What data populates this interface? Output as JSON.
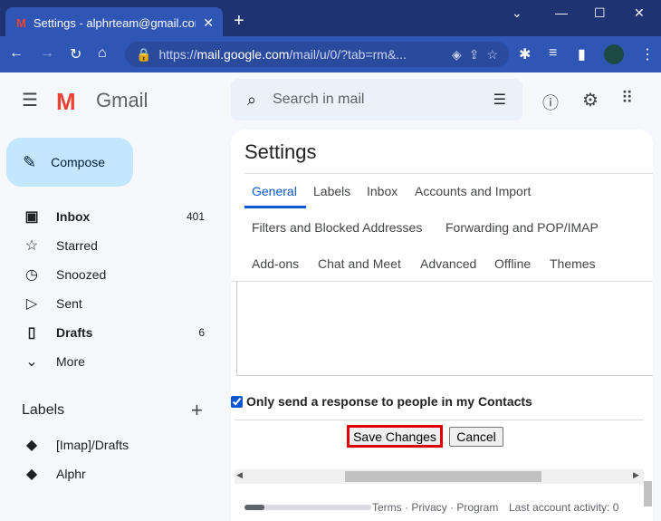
{
  "browser": {
    "tab_title": "Settings - alphrteam@gmail.com",
    "url_prefix": "https://",
    "url_domain": "mail.google.com",
    "url_path": "/mail/u/0/?tab=rm&..."
  },
  "gmail": {
    "logo_text": "Gmail",
    "search_placeholder": "Search in mail",
    "compose_label": "Compose",
    "nav": [
      {
        "label": "Inbox",
        "count": "401",
        "icon": "inbox-icon",
        "bold": true
      },
      {
        "label": "Starred",
        "icon": "star-icon"
      },
      {
        "label": "Snoozed",
        "icon": "clock-icon"
      },
      {
        "label": "Sent",
        "icon": "send-icon"
      },
      {
        "label": "Drafts",
        "count": "6",
        "icon": "draft-icon",
        "bold": true
      },
      {
        "label": "More",
        "icon": "chevron-down-icon"
      }
    ],
    "labels_heading": "Labels",
    "labels": [
      "[Imap]/Drafts",
      "Alphr"
    ]
  },
  "settings": {
    "title": "Settings",
    "tabs": [
      "General",
      "Labels",
      "Inbox",
      "Accounts and Import",
      "Filters and Blocked Addresses",
      "Forwarding and POP/IMAP",
      "Add-ons",
      "Chat and Meet",
      "Advanced",
      "Offline",
      "Themes"
    ],
    "active_tab": "General",
    "contacts_checkbox_label": "Only send a response to people in my Contacts",
    "contacts_checked": true,
    "save_label": "Save Changes",
    "cancel_label": "Cancel",
    "footer_links": "Terms · Privacy · Program",
    "last_activity": "Last account activity: 0"
  },
  "colors": {
    "accent": "#0b57d0",
    "highlight": "#e00000"
  }
}
